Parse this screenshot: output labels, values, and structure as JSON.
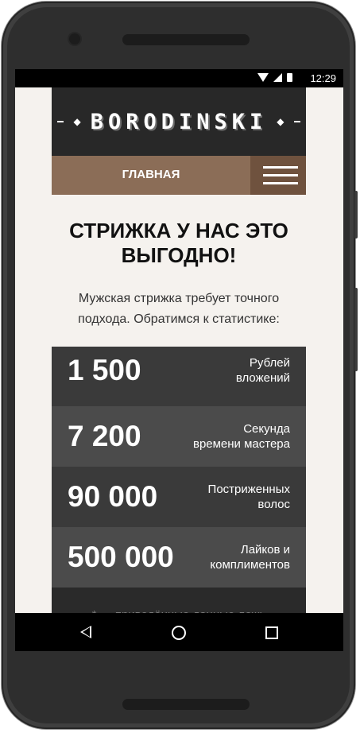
{
  "status_bar": {
    "time": "12:29"
  },
  "header": {
    "logo": "BORODINSKI",
    "logo_deco": "◆"
  },
  "nav": {
    "main_label": "ГЛАВНАЯ"
  },
  "content": {
    "headline": "СТРИЖКА У НАС ЭТО ВЫГОДНО!",
    "lead": "Мужская стрижка требует точного подхода. Обратимся к статистике:",
    "stats": [
      {
        "value": "1 500",
        "label_line1": "Рублей",
        "label_line2": "вложений"
      },
      {
        "value": "7 200",
        "label_line1": "Секунда",
        "label_line2": "времени мастера"
      },
      {
        "value": "90 000",
        "label_line1": "Постриженных",
        "label_line2": "волос"
      },
      {
        "value": "500 000",
        "label_line1": "Лайков и",
        "label_line2": "комплиментов"
      }
    ],
    "footnote": "* — приведённые данные ложь"
  },
  "colors": {
    "header_bg": "#282828",
    "nav_bg": "#8b6d57",
    "menu_bg": "#6f523e",
    "page_bg": "#f5f2ee"
  },
  "icons": [
    "wifi-icon",
    "signal-icon",
    "battery-icon",
    "hamburger-menu-icon",
    "back-icon",
    "home-icon",
    "recents-icon"
  ]
}
